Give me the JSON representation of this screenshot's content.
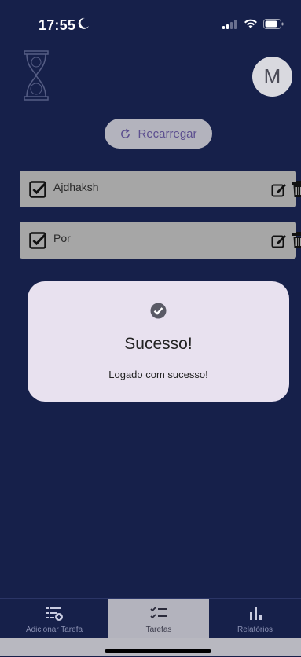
{
  "status_bar": {
    "time": "17:55"
  },
  "header": {
    "avatar_initial": "M"
  },
  "reload_button": {
    "label": "Recarregar"
  },
  "tasks": [
    {
      "name": "Ajdhaksh",
      "done": true
    },
    {
      "name": "Por",
      "done": true
    }
  ],
  "modal": {
    "title": "Sucesso!",
    "message": "Logado com sucesso!"
  },
  "tabbar": {
    "tabs": [
      {
        "label": "Adicionar Tarefa",
        "icon": "add-task-icon",
        "active": false
      },
      {
        "label": "Tarefas",
        "icon": "task-list-icon",
        "active": true
      },
      {
        "label": "Relatórios",
        "icon": "bar-chart-icon",
        "active": false
      }
    ]
  },
  "colors": {
    "background": "#16204a",
    "card": "#a6a6a6",
    "modal": "#e8e1ef",
    "accent": "#5c4f8f"
  }
}
